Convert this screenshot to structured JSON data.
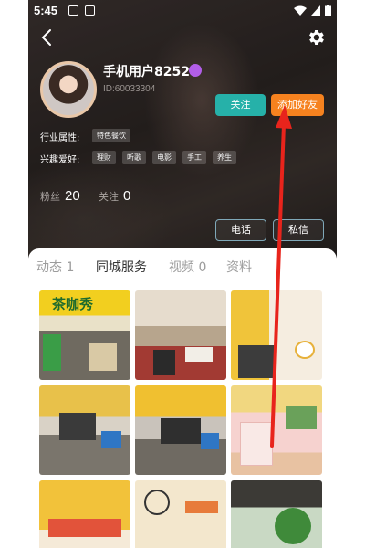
{
  "status_bar": {
    "time": "5:45"
  },
  "profile": {
    "username": "手机用户8252",
    "user_id": "ID:60033304",
    "follow_label": "关注",
    "add_friend_label": "添加好友",
    "industry_label": "行业属性:",
    "industry_tag": "特色餐饮",
    "hobby_label": "兴趣爱好:",
    "hobby_tags": [
      "理财",
      "听歌",
      "电影",
      "手工",
      "养生"
    ],
    "fans_label": "粉丝",
    "fans_count": "20",
    "following_label": "关注",
    "following_count": "0",
    "call_label": "电话",
    "message_label": "私信"
  },
  "tabs": [
    {
      "label": "动态 1",
      "active": false
    },
    {
      "label": "同城服务",
      "active": true
    },
    {
      "label": "视频 0",
      "active": false
    },
    {
      "label": "资料",
      "active": false
    }
  ],
  "photos": {
    "tile_1_sign_text": "茶咖秀"
  },
  "colors": {
    "follow_button": "#26b1a9",
    "add_friend_button": "#f6821f",
    "annotation_arrow": "#e8241c"
  }
}
